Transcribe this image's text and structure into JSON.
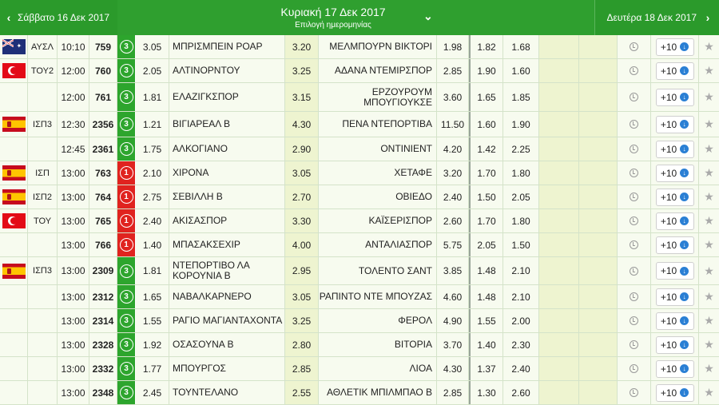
{
  "header": {
    "prev_day": "Σάββατο 16 Δεκ 2017",
    "current_day": "Κυριακή 17 Δεκ 2017",
    "date_select": "Επιλογή ημερομηνίας",
    "next_day": "Δευτέρα 18 Δεκ 2017"
  },
  "icons": {
    "prev": "chevron-left-icon",
    "next": "chevron-right-icon",
    "dropdown": "double-chevron-down-icon"
  },
  "colors": {
    "header_green": "#2b9a2b",
    "badge_green": "#2da52d",
    "badge_red": "#e0231f"
  },
  "rows": [
    {
      "flag": "au",
      "league": "ΑΥΣΛ",
      "time": "10:10",
      "code": "759",
      "badge": "3",
      "badge_color": "green",
      "odd1": "3.05",
      "home": "ΜΠΡΙΣΜΠΕΙΝ ΡΟΑΡ",
      "oddx": "3.20",
      "away": "ΜΕΛΜΠΟΥΡΝ ΒΙΚΤΟΡΙ",
      "odd2": "1.98",
      "u1": "1.82",
      "u2": "1.68",
      "more": "+10",
      "h": 30
    },
    {
      "flag": "tr",
      "league": "ΤΟΥ2",
      "time": "12:00",
      "code": "760",
      "badge": "3",
      "badge_color": "green",
      "odd1": "2.05",
      "home": "ΑΛΤΙΝΟΡΝΤΟΥ",
      "oddx": "3.25",
      "away": "ΑΔΑΝΑ ΝΤΕΜΙΡΣΠΟΡ",
      "odd2": "2.85",
      "u1": "1.90",
      "u2": "1.60",
      "more": "+10",
      "h": 30
    },
    {
      "flag": "",
      "league": "",
      "time": "12:00",
      "code": "761",
      "badge": "3",
      "badge_color": "green",
      "odd1": "1.81",
      "home": "ΕΛΑΖΙΓΚΣΠΟΡ",
      "oddx": "3.15",
      "away": "ΕΡΖΟΥΡΟΥΜ ΜΠΟΥΓΙΟΥΚΣΕ",
      "odd2": "3.60",
      "u1": "1.65",
      "u2": "1.85",
      "more": "+10",
      "h": 36
    },
    {
      "flag": "es",
      "league": "ΙΣΠ3",
      "time": "12:30",
      "code": "2356",
      "badge": "3",
      "badge_color": "green",
      "odd1": "1.21",
      "home": "ΒΙΓΙΑΡΕΑΛ Β",
      "oddx": "4.30",
      "away": "ΠΕΝΑ ΝΤΕΠΟΡΤΙΒΑ",
      "odd2": "11.50",
      "u1": "1.60",
      "u2": "1.90",
      "more": "+10",
      "h": 32
    },
    {
      "flag": "",
      "league": "",
      "time": "12:45",
      "code": "2361",
      "badge": "3",
      "badge_color": "green",
      "odd1": "1.75",
      "home": "ΑΛΚΟΓΙΑΝΟ",
      "oddx": "2.90",
      "away": "ΟΝΤΙΝΙΕΝΤ",
      "odd2": "4.20",
      "u1": "1.42",
      "u2": "2.25",
      "more": "+10",
      "h": 30
    },
    {
      "flag": "es",
      "league": "ΙΣΠ",
      "time": "13:00",
      "code": "763",
      "badge": "1",
      "badge_color": "red",
      "odd1": "2.10",
      "home": "ΧΙΡΟΝΑ",
      "oddx": "3.05",
      "away": "ΧΕΤΑΦΕ",
      "odd2": "3.20",
      "u1": "1.70",
      "u2": "1.80",
      "more": "+10",
      "h": 30
    },
    {
      "flag": "es",
      "league": "ΙΣΠ2",
      "time": "13:00",
      "code": "764",
      "badge": "1",
      "badge_color": "red",
      "odd1": "2.75",
      "home": "ΣΕΒΙΛΛΗ Β",
      "oddx": "2.70",
      "away": "ΟΒΙΕΔΟ",
      "odd2": "2.40",
      "u1": "1.50",
      "u2": "2.05",
      "more": "+10",
      "h": 30
    },
    {
      "flag": "tr",
      "league": "ΤΟΥ",
      "time": "13:00",
      "code": "765",
      "badge": "1",
      "badge_color": "red",
      "odd1": "2.40",
      "home": "ΑΚΙΣΑΣΠΟΡ",
      "oddx": "3.30",
      "away": "ΚΑΪΣΕΡΙΣΠΟΡ",
      "odd2": "2.60",
      "u1": "1.70",
      "u2": "1.80",
      "more": "+10",
      "h": 30
    },
    {
      "flag": "",
      "league": "",
      "time": "13:00",
      "code": "766",
      "badge": "1",
      "badge_color": "red",
      "odd1": "1.40",
      "home": "ΜΠΑΣΑΚΣΕΧΙΡ",
      "oddx": "4.00",
      "away": "ΑΝΤΑΛΙΑΣΠΟΡ",
      "odd2": "5.75",
      "u1": "2.05",
      "u2": "1.50",
      "more": "+10",
      "h": 30
    },
    {
      "flag": "es",
      "league": "ΙΣΠ3",
      "time": "13:00",
      "code": "2309",
      "badge": "3",
      "badge_color": "green",
      "odd1": "1.81",
      "home": "ΝΤΕΠΟΡΤΙΒΟ ΛΑ ΚΟΡΟΥΝΙΑ Β",
      "oddx": "2.95",
      "away": "ΤΟΛΕΝΤΟ ΣΑΝΤ",
      "odd2": "3.85",
      "u1": "1.48",
      "u2": "2.10",
      "more": "+10",
      "h": 35
    },
    {
      "flag": "",
      "league": "",
      "time": "13:00",
      "code": "2312",
      "badge": "3",
      "badge_color": "green",
      "odd1": "1.65",
      "home": "ΝΑΒΑΛΚΑΡΝΕΡΟ",
      "oddx": "3.05",
      "away": "ΡΑΠΙΝΤΟ ΝΤΕ ΜΠΟΥΖΑΣ",
      "odd2": "4.60",
      "u1": "1.48",
      "u2": "2.10",
      "more": "+10",
      "h": 30
    },
    {
      "flag": "",
      "league": "",
      "time": "13:00",
      "code": "2314",
      "badge": "3",
      "badge_color": "green",
      "odd1": "1.55",
      "home": "ΡΑΓΙΟ ΜΑΓΙΑΝΤΑΧΟΝΤΑ",
      "oddx": "3.25",
      "away": "ΦΕΡΟΛ",
      "odd2": "4.90",
      "u1": "1.55",
      "u2": "2.00",
      "more": "+10",
      "h": 30
    },
    {
      "flag": "",
      "league": "",
      "time": "13:00",
      "code": "2328",
      "badge": "3",
      "badge_color": "green",
      "odd1": "1.92",
      "home": "ΟΣΑΣΟΥΝΑ Β",
      "oddx": "2.80",
      "away": "ΒΙΤΟΡΙΑ",
      "odd2": "3.70",
      "u1": "1.40",
      "u2": "2.30",
      "more": "+10",
      "h": 30
    },
    {
      "flag": "",
      "league": "",
      "time": "13:00",
      "code": "2332",
      "badge": "3",
      "badge_color": "green",
      "odd1": "1.77",
      "home": "ΜΠΟΥΡΓΟΣ",
      "oddx": "2.85",
      "away": "ΛΙΟΑ",
      "odd2": "4.30",
      "u1": "1.37",
      "u2": "2.40",
      "more": "+10",
      "h": 30
    },
    {
      "flag": "",
      "league": "",
      "time": "13:00",
      "code": "2348",
      "badge": "3",
      "badge_color": "green",
      "odd1": "2.45",
      "home": "ΤΟΥΝΤΕΛΑΝΟ",
      "oddx": "2.55",
      "away": "ΑΘΛΕΤΙΚ ΜΠΙΛΜΠΑΟ Β",
      "odd2": "2.85",
      "u1": "1.30",
      "u2": "2.60",
      "more": "+10",
      "h": 30
    }
  ]
}
